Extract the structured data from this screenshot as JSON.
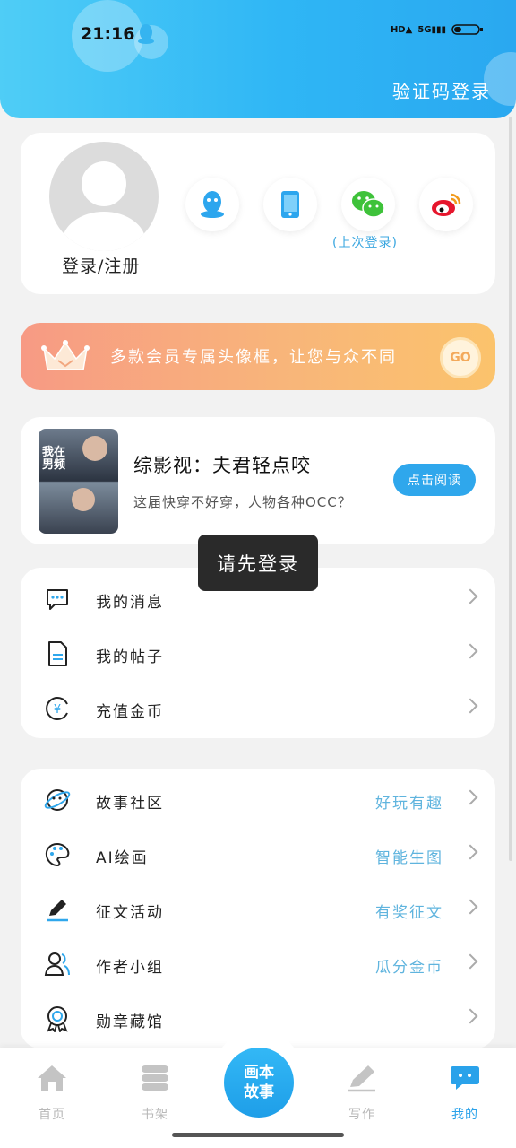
{
  "status_bar": {
    "time": "21:16",
    "icons": [
      "HD",
      "5G",
      "battery"
    ]
  },
  "header": {
    "login_code": "验证码登录"
  },
  "profile": {
    "login_register": "登录/注册",
    "social": [
      "qq",
      "phone",
      "wechat",
      "weibo"
    ],
    "last_login_label": "(上次登录)"
  },
  "vip_banner": {
    "text": "多款会员专属头像框，让您与众不同",
    "button": "GO"
  },
  "book": {
    "cover_text": "我在男频",
    "title": "综影视：夫君轻点咬",
    "description": "这届快穿不好穿，人物各种OCC？",
    "read_button": "点击阅读"
  },
  "toast": "请先登录",
  "menu_primary": [
    {
      "icon": "message-icon",
      "label": "我的消息"
    },
    {
      "icon": "post-icon",
      "label": "我的帖子"
    },
    {
      "icon": "coin-icon",
      "label": "充值金币"
    }
  ],
  "menu_secondary": [
    {
      "icon": "community-icon",
      "label": "故事社区",
      "tag": "好玩有趣"
    },
    {
      "icon": "palette-icon",
      "label": "AI绘画",
      "tag": "智能生图"
    },
    {
      "icon": "pen-icon",
      "label": "征文活动",
      "tag": "有奖征文"
    },
    {
      "icon": "author-group-icon",
      "label": "作者小组",
      "tag": "瓜分金币"
    },
    {
      "icon": "badge-icon",
      "label": "勋章藏馆",
      "tag": ""
    }
  ],
  "tabbar": {
    "home": "首页",
    "bookshelf": "书架",
    "center_line1": "画本",
    "center_line2": "故事",
    "write": "写作",
    "mine": "我的"
  },
  "colors": {
    "accent": "#2fa7ec",
    "header": "#2fb6f5",
    "vip_start": "#f79a84",
    "vip_end": "#fbc36c"
  }
}
